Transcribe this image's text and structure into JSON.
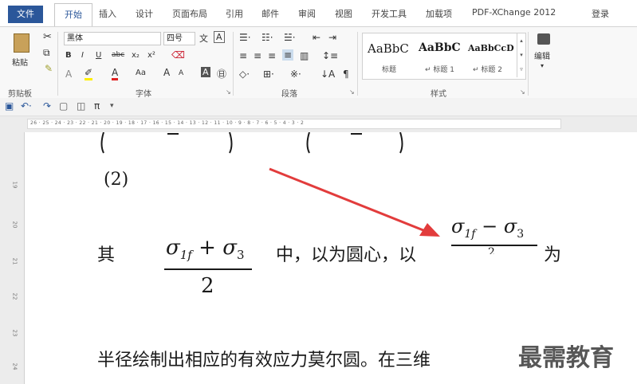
{
  "tabs": {
    "file": "文件",
    "items": [
      "开始",
      "插入",
      "设计",
      "页面布局",
      "引用",
      "邮件",
      "审阅",
      "视图",
      "开发工具",
      "加载项",
      "PDF-XChange 2012"
    ],
    "login": "登录"
  },
  "ribbon": {
    "clipboard": {
      "paste": "粘贴",
      "label": "剪贴板"
    },
    "font": {
      "name": "黑体",
      "size": "四号",
      "label": "字体",
      "bold": "B",
      "italic": "I",
      "underline": "U",
      "strike": "abc",
      "sub": "x₂",
      "sup": "x²",
      "aa": "Aa",
      "grow": "A",
      "shrink": "A"
    },
    "paragraph": {
      "label": "段落"
    },
    "styles": {
      "label": "样式",
      "items": [
        {
          "sample": "AaBbC",
          "name": "标题"
        },
        {
          "sample": "AaBbC",
          "name": "↵ 标题 1"
        },
        {
          "sample": "AaBbCcD",
          "name": "↵ 标题 2"
        }
      ]
    },
    "editing": {
      "label": "编辑"
    }
  },
  "qat": {
    "pi": "π"
  },
  "ruler": {
    "ticks": "26 · 25 · 24 · 23 · 22 · 21 · 20 · 19 · 18 · 17 · 16 · 15 · 14 · 13 · 12 · 11 · 10 · 9 · 8 · 7 · 6 · 5 · 4 · 3 · 2",
    "vertical": [
      "19",
      "20",
      "21",
      "22",
      "23",
      "24"
    ]
  },
  "document": {
    "item_number": "(2)",
    "qi": "其",
    "frac1_num": "σ1f + σ3",
    "frac1_den": "2",
    "middle_text": "中，以为圆心，以",
    "frac2_num": "σ1f − σ3",
    "frac2_den": "2",
    "wei": "为",
    "line2": "半径绘制出相应的有效应力莫尔圆。在三维"
  },
  "watermark": "最需教育",
  "colors": {
    "accent": "#2b579a",
    "arrow": "#e23c3c"
  }
}
